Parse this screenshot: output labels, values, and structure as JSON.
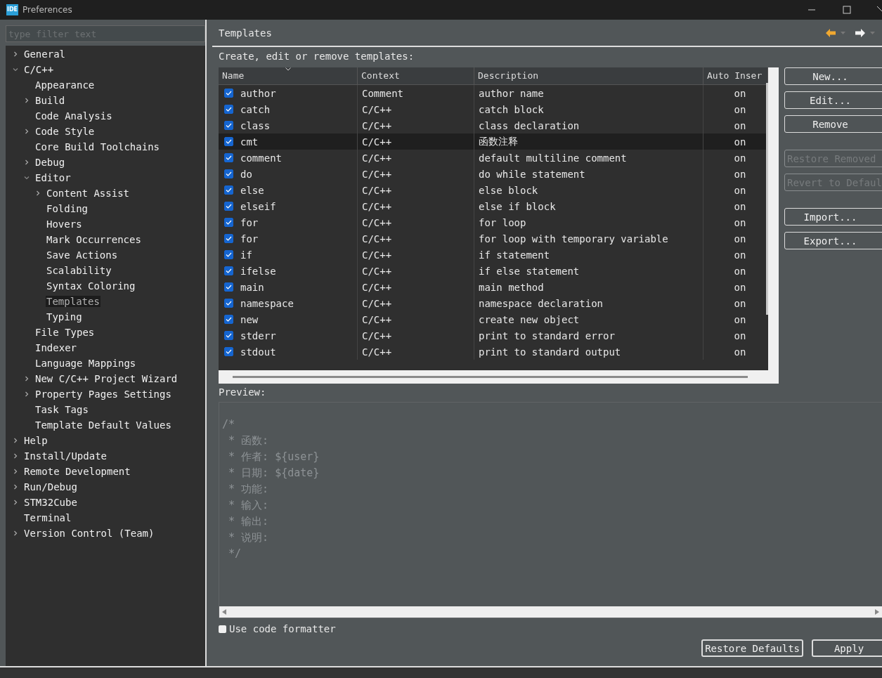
{
  "window": {
    "app_badge": "IDE",
    "title": "Preferences"
  },
  "filter": {
    "placeholder": "type filter text"
  },
  "tree": [
    {
      "label": "General",
      "expanded": false,
      "selected": false
    },
    {
      "label": "C/C++",
      "expanded": true,
      "selected": false,
      "children": [
        {
          "label": "Appearance",
          "selected": false
        },
        {
          "label": "Build",
          "expanded": false,
          "selected": false
        },
        {
          "label": "Code Analysis",
          "selected": false
        },
        {
          "label": "Code Style",
          "expanded": false,
          "selected": false
        },
        {
          "label": "Core Build Toolchains",
          "selected": false
        },
        {
          "label": "Debug",
          "expanded": false,
          "selected": false
        },
        {
          "label": "Editor",
          "expanded": true,
          "selected": false,
          "children": [
            {
              "label": "Content Assist",
              "expanded": false,
              "selected": false
            },
            {
              "label": "Folding",
              "selected": false
            },
            {
              "label": "Hovers",
              "selected": false
            },
            {
              "label": "Mark Occurrences",
              "selected": false
            },
            {
              "label": "Save Actions",
              "selected": false
            },
            {
              "label": "Scalability",
              "selected": false
            },
            {
              "label": "Syntax Coloring",
              "selected": false
            },
            {
              "label": "Templates",
              "selected": true
            },
            {
              "label": "Typing",
              "selected": false
            }
          ]
        },
        {
          "label": "File Types",
          "selected": false
        },
        {
          "label": "Indexer",
          "selected": false
        },
        {
          "label": "Language Mappings",
          "selected": false
        },
        {
          "label": "New C/C++ Project Wizard",
          "expanded": false,
          "selected": false
        },
        {
          "label": "Property Pages Settings",
          "expanded": false,
          "selected": false
        },
        {
          "label": "Task Tags",
          "selected": false
        },
        {
          "label": "Template Default Values",
          "selected": false
        }
      ]
    },
    {
      "label": "Help",
      "expanded": false,
      "selected": false
    },
    {
      "label": "Install/Update",
      "expanded": false,
      "selected": false
    },
    {
      "label": "Remote Development",
      "expanded": false,
      "selected": false
    },
    {
      "label": "Run/Debug",
      "expanded": false,
      "selected": false
    },
    {
      "label": "STM32Cube",
      "expanded": false,
      "selected": false
    },
    {
      "label": "Terminal",
      "selected": false
    },
    {
      "label": "Version Control (Team)",
      "expanded": false,
      "selected": false
    }
  ],
  "page": {
    "title": "Templates",
    "intro": "Create, edit or remove templates:"
  },
  "table": {
    "columns": [
      "Name",
      "Context",
      "Description",
      "Auto Inser"
    ],
    "rows": [
      {
        "name": "author",
        "checked": true,
        "context": "Comment",
        "description": "author name",
        "auto_insert": "on",
        "selected": false
      },
      {
        "name": "catch",
        "checked": true,
        "context": "C/C++",
        "description": "catch block",
        "auto_insert": "on",
        "selected": false
      },
      {
        "name": "class",
        "checked": true,
        "context": "C/C++",
        "description": "class declaration",
        "auto_insert": "on",
        "selected": false
      },
      {
        "name": "cmt",
        "checked": true,
        "context": "C/C++",
        "description": "函数注释",
        "auto_insert": "on",
        "selected": true
      },
      {
        "name": "comment",
        "checked": true,
        "context": "C/C++",
        "description": "default multiline comment",
        "auto_insert": "on",
        "selected": false
      },
      {
        "name": "do",
        "checked": true,
        "context": "C/C++",
        "description": "do while statement",
        "auto_insert": "on",
        "selected": false
      },
      {
        "name": "else",
        "checked": true,
        "context": "C/C++",
        "description": "else block",
        "auto_insert": "on",
        "selected": false
      },
      {
        "name": "elseif",
        "checked": true,
        "context": "C/C++",
        "description": "else if block",
        "auto_insert": "on",
        "selected": false
      },
      {
        "name": "for",
        "checked": true,
        "context": "C/C++",
        "description": "for loop",
        "auto_insert": "on",
        "selected": false
      },
      {
        "name": "for",
        "checked": true,
        "context": "C/C++",
        "description": "for loop with temporary variable",
        "auto_insert": "on",
        "selected": false
      },
      {
        "name": "if",
        "checked": true,
        "context": "C/C++",
        "description": "if statement",
        "auto_insert": "on",
        "selected": false
      },
      {
        "name": "ifelse",
        "checked": true,
        "context": "C/C++",
        "description": "if else statement",
        "auto_insert": "on",
        "selected": false
      },
      {
        "name": "main",
        "checked": true,
        "context": "C/C++",
        "description": "main method",
        "auto_insert": "on",
        "selected": false
      },
      {
        "name": "namespace",
        "checked": true,
        "context": "C/C++",
        "description": "namespace declaration",
        "auto_insert": "on",
        "selected": false
      },
      {
        "name": "new",
        "checked": true,
        "context": "C/C++",
        "description": "create new object",
        "auto_insert": "on",
        "selected": false
      },
      {
        "name": "stderr",
        "checked": true,
        "context": "C/C++",
        "description": "print to standard error",
        "auto_insert": "on",
        "selected": false
      },
      {
        "name": "stdout",
        "checked": true,
        "context": "C/C++",
        "description": "print to standard output",
        "auto_insert": "on",
        "selected": false
      }
    ]
  },
  "side_buttons": [
    {
      "label": "New...",
      "disabled": false
    },
    {
      "label": "Edit...",
      "disabled": false
    },
    {
      "label": "Remove",
      "disabled": false
    },
    {
      "label": "Restore Removed",
      "disabled": true
    },
    {
      "label": "Revert to Defaul",
      "disabled": true
    },
    {
      "label": "Import...",
      "disabled": false
    },
    {
      "label": "Export...",
      "disabled": false
    }
  ],
  "preview": {
    "label": "Preview:",
    "lines": [
      "/*",
      " * 函数:",
      " * 作者: ${user}",
      " * 日期: ${date}",
      " * 功能:",
      " * 输入:",
      " * 输出:",
      " * 说明:",
      " */"
    ]
  },
  "use_formatter": {
    "label": "Use code formatter",
    "checked": false
  },
  "bottom_buttons": [
    "Restore Defaults",
    "Apply"
  ]
}
